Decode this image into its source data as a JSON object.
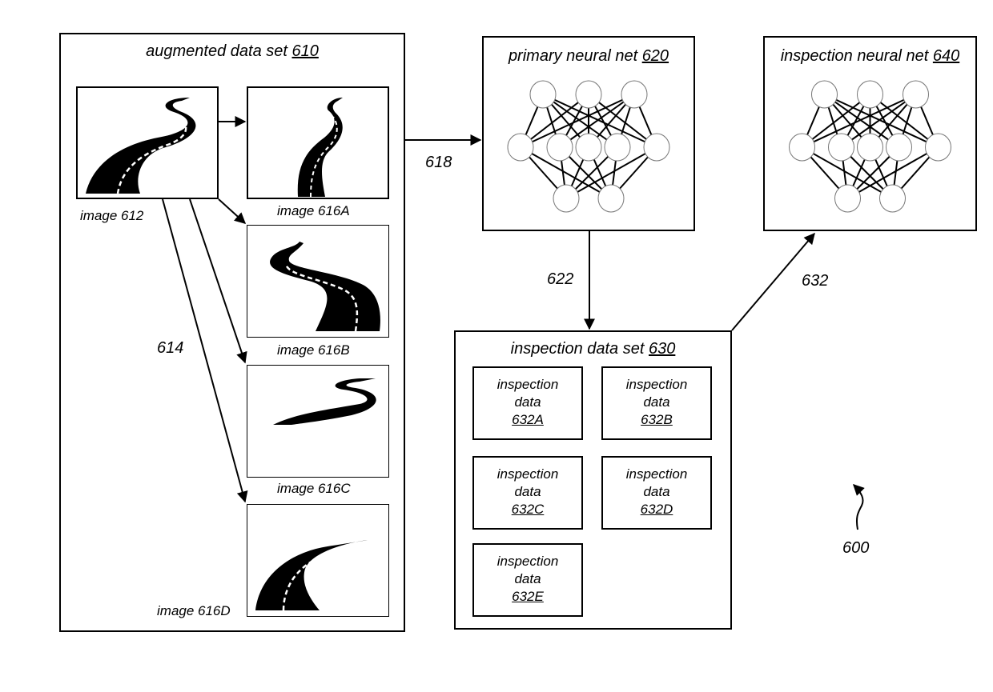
{
  "figure_ref": "600",
  "augmented_data_set": {
    "title": "augmented data set ",
    "ref": "610",
    "source_image": {
      "label": "image 612",
      "icon": "winding-road-icon"
    },
    "augmentation_arrow_label": "614",
    "augmented_images": [
      {
        "label": "image 616A",
        "icon": "winding-road-icon"
      },
      {
        "label": "image 616B",
        "icon": "winding-road-icon"
      },
      {
        "label": "image 616C",
        "icon": "winding-road-icon"
      },
      {
        "label": "image 616D",
        "icon": "winding-road-icon"
      }
    ]
  },
  "primary_net": {
    "title": "primary neural net ",
    "ref": "620",
    "icon": "neural-network-icon"
  },
  "inspection_net": {
    "title": "inspection neural net ",
    "ref": "640",
    "icon": "neural-network-icon"
  },
  "inspection_data_set": {
    "title": "inspection data set ",
    "ref": "630",
    "items": [
      {
        "line1": "inspection",
        "line2": "data",
        "ref": "632A"
      },
      {
        "line1": "inspection",
        "line2": "data",
        "ref": "632B"
      },
      {
        "line1": "inspection",
        "line2": "data",
        "ref": "632C"
      },
      {
        "line1": "inspection",
        "line2": "data",
        "ref": "632D"
      },
      {
        "line1": "inspection",
        "line2": "data",
        "ref": "632E"
      }
    ]
  },
  "arrows": {
    "to_primary": "618",
    "to_inspection_set": "622",
    "to_inspection_net": "632"
  }
}
